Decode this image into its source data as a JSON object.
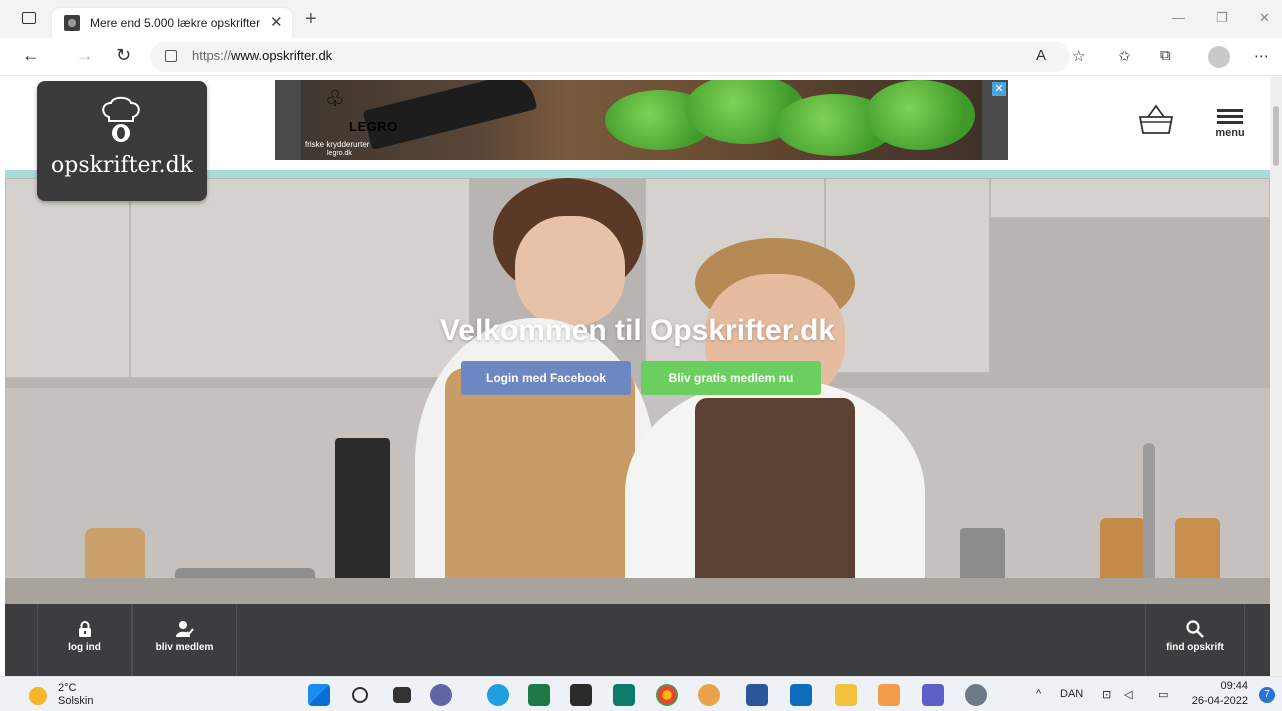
{
  "browser": {
    "tab_title": "Mere end 5.000 lækre opskrifter",
    "url_scheme": "https://",
    "url_host": "www.opskrifter.dk"
  },
  "site": {
    "logo_text": "opskrifter.dk",
    "ad": {
      "brand": "LEGRO",
      "tagline": "friske krydderurter",
      "web": "legro.dk"
    },
    "menu_label": "menu"
  },
  "hero": {
    "title": "Velkommen til Opskrifter.dk",
    "facebook_button": "Login med Facebook",
    "join_button": "Bliv gratis medlem nu"
  },
  "bottom_bar": {
    "login": "log ind",
    "join": "bliv medlem",
    "search": "find opskrift"
  },
  "taskbar": {
    "temperature": "2°C",
    "weather": "Solskin",
    "language": "DAN",
    "time": "09:44",
    "date": "26-04-2022",
    "notification_count": "7"
  },
  "colors": {
    "teal_stripe": "#a8dcd7",
    "facebook_blue": "#6d87c2",
    "join_green": "#6acf5f",
    "bottom_bar": "#3b3d3e"
  }
}
